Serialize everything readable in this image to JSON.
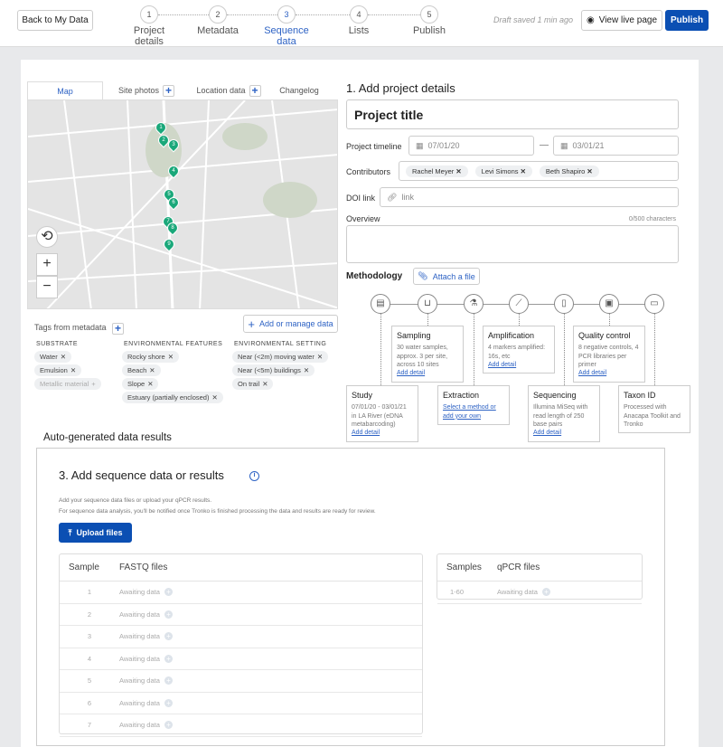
{
  "header": {
    "back": "Back to My Data",
    "steps": [
      {
        "n": "1",
        "label": "Project details"
      },
      {
        "n": "2",
        "label": "Metadata"
      },
      {
        "n": "3",
        "label": "Sequence data"
      },
      {
        "n": "4",
        "label": "Lists"
      },
      {
        "n": "5",
        "label": "Publish"
      }
    ],
    "active_step": "3",
    "draft": "Draft saved 1 min ago",
    "view_live": "View live page",
    "publish": "Publish"
  },
  "map_panel": {
    "tabs": [
      "Map",
      "Site photos",
      "Location data",
      "Changelog"
    ],
    "markers": [
      "1",
      "2",
      "3",
      "4",
      "5",
      "6",
      "7",
      "8",
      "9"
    ],
    "zoom_in": "+",
    "zoom_out": "−"
  },
  "tags": {
    "title": "Tags from metadata",
    "add_manage": "Add or manage data",
    "groups": [
      {
        "name": "SUBSTRATE",
        "items": [
          "Water",
          "Emulsion"
        ],
        "disabled": "Metallic material"
      },
      {
        "name": "ENVIRONMENTAL FEATURES",
        "items": [
          "Rocky shore",
          "Beach",
          "Slope",
          "Estuary (partially enclosed)"
        ]
      },
      {
        "name": "ENVIRONMENTAL SETTING",
        "items": [
          "Near (<2m) moving water",
          "Near (<5m) buildings",
          "On trail"
        ]
      }
    ]
  },
  "details": {
    "heading": "1. Add project details",
    "project_title": "Project title",
    "timeline_label": "Project timeline",
    "start": "07/01/20",
    "end": "03/01/21",
    "contributors_label": "Contributors",
    "contributors": [
      "Rachel Meyer",
      "Levi Simons",
      "Beth Shapiro"
    ],
    "doi_label": "DOI link",
    "doi_placeholder": "link",
    "overview_label": "Overview",
    "overview_count": "0/500 characters",
    "methodology_label": "Methodology",
    "attach": "Attach a file"
  },
  "methodology": [
    {
      "title": "Study",
      "text": "07/01/20 - 03/01/21 in LA River (eDNA metabarcoding)",
      "link": "Add detail"
    },
    {
      "title": "Sampling",
      "text": "30 water samples, approx. 3 per site, across 10 sites",
      "link": "Add detail"
    },
    {
      "title": "Extraction",
      "text": "",
      "link": "Select a method or add your own"
    },
    {
      "title": "Amplification",
      "text": "4 markers amplified: 16s, etc",
      "link": "Add detail"
    },
    {
      "title": "Sequencing",
      "text": "Illumina MiSeq with read length of 250 base pairs",
      "link": "Add detail"
    },
    {
      "title": "Quality control",
      "text": "8 negative controls, 4 PCR libraries per primer",
      "link": "Add detail"
    },
    {
      "title": "Taxon ID",
      "text": "Processed with Anacapa Toolkit and Tronko",
      "link": ""
    }
  ],
  "results": {
    "auto_heading": "Auto-generated data results",
    "heading": "3. Add sequence data or results",
    "desc1": "Add your sequence data files or upload your qPCR results.",
    "desc2": "For sequence data analysis, you'll be notified once Tronko is finished processing the data and results are ready for review.",
    "upload": "Upload files",
    "fastq": {
      "headers": [
        "Sample",
        "FASTQ files"
      ],
      "rows": [
        {
          "s": "1",
          "v": "Awaiting data"
        },
        {
          "s": "2",
          "v": "Awaiting data"
        },
        {
          "s": "3",
          "v": "Awaiting data"
        },
        {
          "s": "4",
          "v": "Awaiting data"
        },
        {
          "s": "5",
          "v": "Awaiting data"
        },
        {
          "s": "6",
          "v": "Awaiting data"
        },
        {
          "s": "7",
          "v": "Awaiting data"
        }
      ]
    },
    "qpcr": {
      "headers": [
        "Samples",
        "qPCR files"
      ],
      "rows": [
        {
          "s": "1-60",
          "v": "Awaiting data"
        }
      ]
    }
  },
  "colors": {
    "accent": "#0b4fb3",
    "link": "#2d62c4",
    "marker": "#1aa87a"
  }
}
